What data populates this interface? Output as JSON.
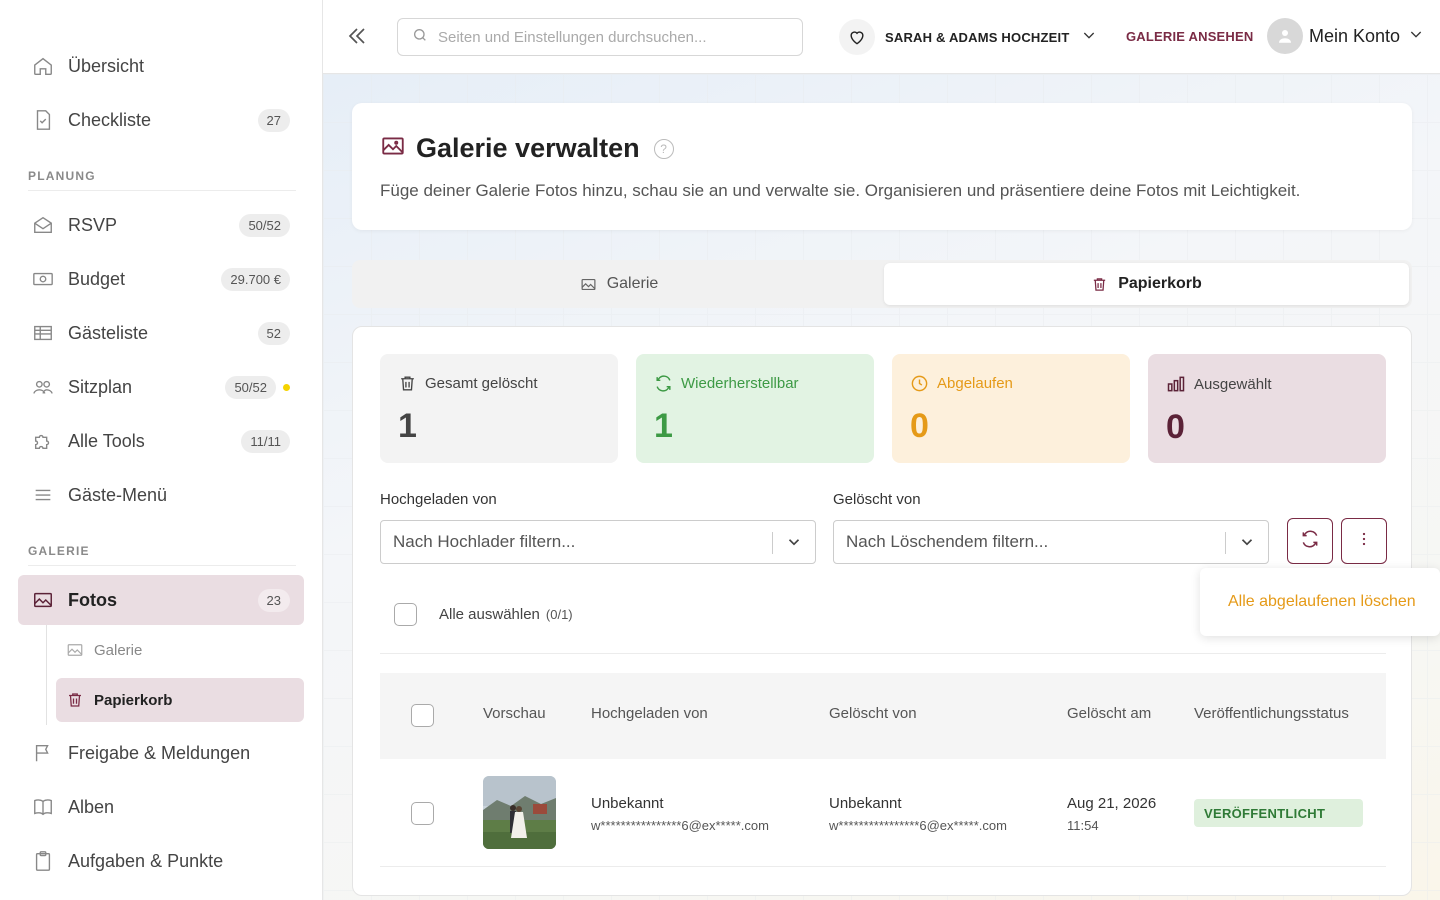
{
  "sidebar": {
    "items": [
      {
        "label": "Übersicht",
        "icon": "home-icon"
      },
      {
        "label": "Checkliste",
        "badge": "27",
        "icon": "checklist-icon"
      },
      {
        "label": "RSVP",
        "badge": "50/52",
        "icon": "envelope-icon"
      },
      {
        "label": "Budget",
        "badge": "29.700 €",
        "icon": "money-icon"
      },
      {
        "label": "Gästeliste",
        "badge": "52",
        "icon": "table-icon"
      },
      {
        "label": "Sitzplan",
        "badge": "50/52",
        "icon": "people-icon"
      },
      {
        "label": "Alle Tools",
        "badge": "11/11",
        "icon": "puzzle-icon"
      },
      {
        "label": "Gäste-Menü",
        "icon": "menu-icon"
      },
      {
        "label": "Fotos",
        "badge": "23",
        "icon": "image-icon"
      },
      {
        "label": "Freigabe & Meldungen",
        "icon": "flag-icon"
      },
      {
        "label": "Alben",
        "icon": "book-icon"
      },
      {
        "label": "Aufgaben & Punkte",
        "icon": "clipboard-icon"
      }
    ],
    "sections": {
      "planung": "PLANUNG",
      "galerie": "GALERIE"
    },
    "sub_items": [
      {
        "label": "Galerie",
        "icon": "image-icon"
      },
      {
        "label": "Papierkorb",
        "icon": "trash-icon"
      }
    ]
  },
  "topbar": {
    "search_placeholder": "Seiten und Einstellungen durchsuchen...",
    "event_name": "SARAH & ADAMS HOCHZEIT",
    "view_gallery": "GALERIE ANSEHEN",
    "account": "Mein Konto"
  },
  "page": {
    "title": "Galerie verwalten",
    "description": "Füge deiner Galerie Fotos hinzu, schau sie an und verwalte sie. Organisieren und präsentiere deine Fotos mit Leichtigkeit.",
    "tabs": [
      "Galerie",
      "Papierkorb"
    ]
  },
  "stats": [
    {
      "label": "Gesamt gelöscht",
      "value": "1",
      "icon": "trash-icon"
    },
    {
      "label": "Wiederherstellbar",
      "value": "1",
      "icon": "refresh-icon"
    },
    {
      "label": "Abgelaufen",
      "value": "0",
      "icon": "clock-icon"
    },
    {
      "label": "Ausgewählt",
      "value": "0",
      "icon": "bar-chart-icon"
    }
  ],
  "filters": {
    "uploaded_by_label": "Hochgeladen von",
    "uploaded_by_placeholder": "Nach Hochlader filtern...",
    "deleted_by_label": "Gelöscht von",
    "deleted_by_placeholder": "Nach Löschendem filtern..."
  },
  "select_all": {
    "label": "Alle auswählen",
    "count": "(0/1)"
  },
  "table": {
    "headers": [
      "Vorschau",
      "Hochgeladen von",
      "Gelöscht von",
      "Gelöscht am",
      "Veröffentlichungsstatus"
    ],
    "rows": [
      {
        "uploaded_name": "Unbekannt",
        "uploaded_email": "w****************6@ex*****.com",
        "deleted_name": "Unbekannt",
        "deleted_email": "w****************6@ex*****.com",
        "deleted_date": "Aug 21, 2026",
        "deleted_time": "11:54",
        "status": "VERÖFFENTLICHT"
      }
    ]
  },
  "dropdown_menu": {
    "option": "Alle abgelaufenen löschen"
  },
  "colors": {
    "brand": "#7a2b45",
    "green": "#3d9a45",
    "orange": "#e59a18"
  }
}
